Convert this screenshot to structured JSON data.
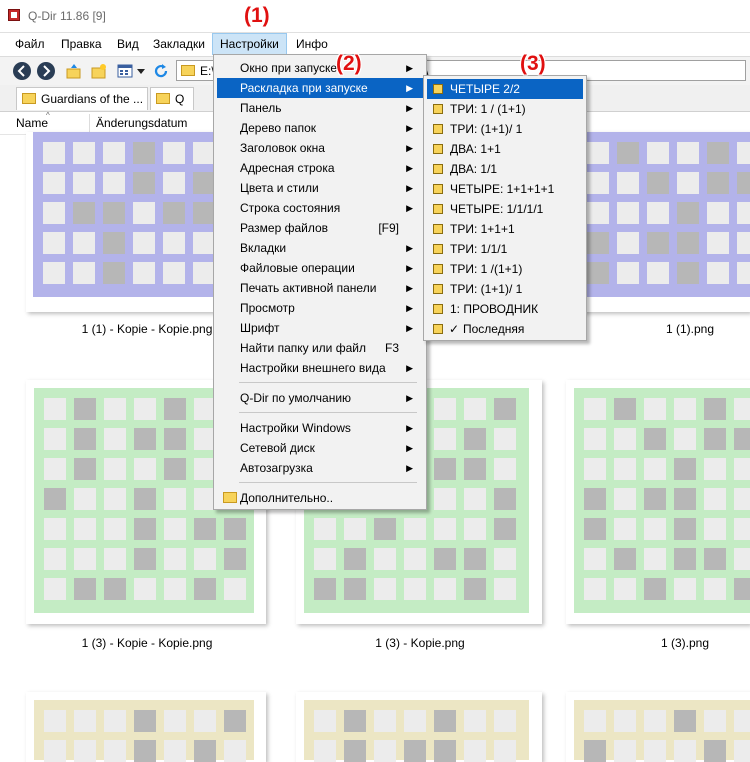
{
  "window": {
    "title": "Q-Dir 11.86 [9]"
  },
  "menubar": {
    "items": [
      "Файл",
      "Правка",
      "Вид",
      "Закладки",
      "Настройки",
      "Инфо"
    ]
  },
  "address": {
    "value": "E:\\",
    "value_tail": "\\"
  },
  "tabs": [
    {
      "label": "Guardians of the ..."
    },
    {
      "label": "Q"
    }
  ],
  "columns": {
    "name": "Name",
    "date": "Änderungsdatum"
  },
  "annotations": {
    "a1": "(1)",
    "a2": "(2)",
    "a3": "(3)"
  },
  "settings_menu": {
    "items": [
      {
        "label": "Окно при запуске",
        "submenu": true
      },
      {
        "label": "Раскладка при запуске",
        "submenu": true,
        "highlight": true
      },
      {
        "label": "Панель",
        "submenu": true
      },
      {
        "label": "Дерево папок",
        "submenu": true
      },
      {
        "label": "Заголовок окна",
        "submenu": true
      },
      {
        "label": "Адресная строка",
        "submenu": true
      },
      {
        "label": "Цвета и стили",
        "submenu": true
      },
      {
        "label": "Строка состояния",
        "submenu": true
      },
      {
        "label": "Размер файлов",
        "shortcut": "[F9]"
      },
      {
        "label": "Вкладки",
        "submenu": true
      },
      {
        "label": "Файловые операции",
        "submenu": true
      },
      {
        "label": "Печать активной панели",
        "submenu": true
      },
      {
        "label": "Просмотр",
        "submenu": true
      },
      {
        "label": "Шрифт",
        "submenu": true
      },
      {
        "label": "Найти папку или файл",
        "shortcut": "F3"
      },
      {
        "label": "Настройки внешнего вида",
        "submenu": true
      }
    ],
    "default_item": "Q-Dir по умолчанию",
    "system_items": [
      {
        "label": "Настройки Windows",
        "submenu": true
      },
      {
        "label": "Сетевой диск",
        "submenu": true
      },
      {
        "label": "Автозагрузка",
        "submenu": true
      }
    ],
    "extra_item": "Дополнительно.."
  },
  "layout_submenu": {
    "items": [
      {
        "label": "ЧЕТЫРЕ 2/2",
        "highlight": true
      },
      {
        "label": "ТРИ: 1 / (1+1)"
      },
      {
        "label": "ТРИ: (1+1)/ 1"
      },
      {
        "label": "ДВА: 1+1"
      },
      {
        "label": "ДВА: 1/1"
      },
      {
        "label": "ЧЕТЫРЕ: 1+1+1+1"
      },
      {
        "label": "ЧЕТЫРЕ: 1/1/1/1"
      },
      {
        "label": "ТРИ: 1+1+1"
      },
      {
        "label": "ТРИ: 1/1/1"
      },
      {
        "label": "ТРИ: 1 /(1+1)"
      },
      {
        "label": "ТРИ: (1+1)/ 1"
      },
      {
        "label": "1: ПРОВОДНИК"
      },
      {
        "label": "Последняя",
        "checked": true,
        "check": "✓"
      }
    ]
  },
  "files": [
    {
      "name": "1 (1) - Kopie - Kopie.png"
    },
    {
      "name": "1 (1).png"
    },
    {
      "name": "1 (3) - Kopie - Kopie.png"
    },
    {
      "name": "1 (3) - Kopie.png"
    },
    {
      "name": "1 (3).png"
    }
  ],
  "colors": {
    "accent_highlight": "#0a64c4",
    "annotation": "#e01010",
    "thumb_blue": "#b3b3ea",
    "thumb_green": "#c4ecc4",
    "thumb_yellow": "#ece6c4"
  }
}
